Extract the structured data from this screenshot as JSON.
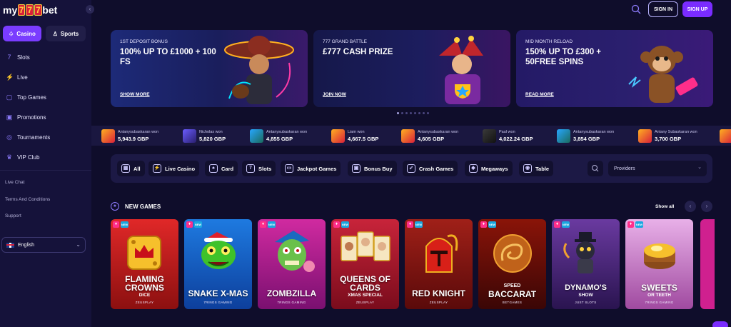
{
  "brand": {
    "prefix": "my",
    "sevens": [
      "7",
      "7",
      "7"
    ],
    "suffix": "bet"
  },
  "header": {
    "signin": "SIGN IN",
    "signup": "SIGN UP"
  },
  "sidebar": {
    "modes": [
      {
        "label": "Casino"
      },
      {
        "label": "Sports"
      }
    ],
    "items": [
      {
        "label": "Slots",
        "icon": "slots-icon"
      },
      {
        "label": "Live",
        "icon": "live-icon"
      },
      {
        "label": "Top Games",
        "icon": "top-games-icon"
      },
      {
        "label": "Promotions",
        "icon": "gift-icon"
      },
      {
        "label": "Tournaments",
        "icon": "trophy-icon"
      },
      {
        "label": "VIP Club",
        "icon": "crown-icon"
      }
    ],
    "links": [
      "Live Chat",
      "Terms And Conditions",
      "Support"
    ],
    "language": "English"
  },
  "promos": [
    {
      "kicker": "1ST DEPOSIT BONUS",
      "title": "100% UP TO £1000 + 100 FS",
      "link": "SHOW MORE",
      "color": "#1b2a6e"
    },
    {
      "kicker": "777 GRAND BATTLE",
      "title": "£777 CASH PRIZE",
      "link": "JOIN NOW",
      "color": "#1a1d5c"
    },
    {
      "kicker": "MID MONTH RELOAD",
      "title": "150% UP TO £300 + 50FREE SPINS",
      "link": "READ MORE",
      "color": "#2a1f6e"
    }
  ],
  "ticker": [
    {
      "name": "Antanysubaskaran won",
      "amount": "5,943.9 GBP"
    },
    {
      "name": "Nicholas won",
      "amount": "5,820 GBP"
    },
    {
      "name": "Antanysubaskaran won",
      "amount": "4,855 GBP"
    },
    {
      "name": "Liam won",
      "amount": "4,667.5 GBP"
    },
    {
      "name": "Antanysubaskaran won",
      "amount": "4,605 GBP"
    },
    {
      "name": "Paul won",
      "amount": "4,022.24 GBP"
    },
    {
      "name": "Antanysubaskaran won",
      "amount": "3,854 GBP"
    },
    {
      "name": "Antany Subaskaran won",
      "amount": "3,700 GBP"
    }
  ],
  "filters": {
    "chips": [
      "All",
      "Live Casino",
      "Card",
      "Slots",
      "Jackpot Games",
      "Bonus Buy",
      "Crash Games",
      "Megaways",
      "Table"
    ],
    "providers_placeholder": "Providers"
  },
  "new_games": {
    "title": "NEW GAMES",
    "show_all": "Show all",
    "games": [
      {
        "title": "FLAMING CROWNS",
        "sub": "DICE",
        "provider": "ZEUSPLAY"
      },
      {
        "title": "SNAKE X-MAS",
        "sub": "",
        "provider": "7RINGS GAMING"
      },
      {
        "title": "ZOMBZILLA",
        "sub": "",
        "provider": "7RINGS GAMING"
      },
      {
        "title": "QUEENS OF CARDS",
        "sub": "XMAS SPECIAL",
        "provider": "ZEUSPLAY"
      },
      {
        "title": "RED KNIGHT",
        "sub": "",
        "provider": "ZEUSPLAY"
      },
      {
        "title": "SPEED",
        "sub": "BACCARAT",
        "provider": "BETGAMES"
      },
      {
        "title": "DYNAMO'S",
        "sub": "SHOW",
        "provider": "JUST SLOTS"
      },
      {
        "title": "SWEETS",
        "sub": "OR TEETH",
        "provider": "7RINGS GAMING"
      }
    ]
  }
}
